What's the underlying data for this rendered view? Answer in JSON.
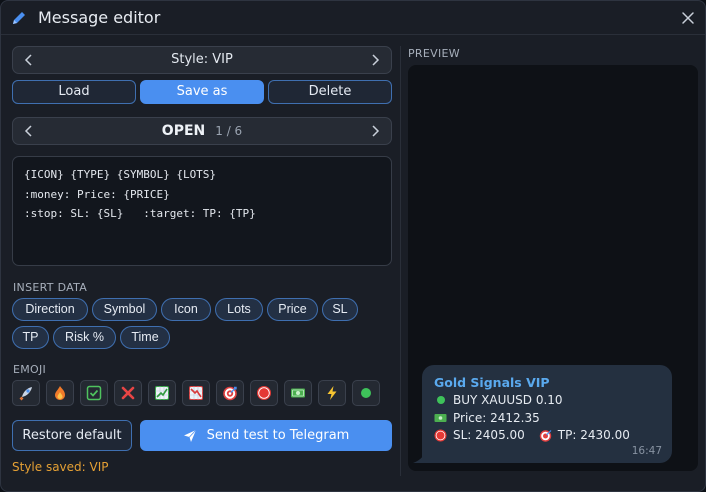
{
  "window": {
    "title": "Message editor"
  },
  "style_nav": {
    "label": "Style: VIP"
  },
  "actions": {
    "load": "Load",
    "save_as": "Save as",
    "delete": "Delete"
  },
  "template_nav": {
    "name": "OPEN",
    "count": "1 / 6"
  },
  "template_lines": [
    "{ICON} {TYPE} {SYMBOL} {LOTS}",
    ":money: Price: {PRICE}",
    ":stop: SL: {SL}   :target: TP: {TP}"
  ],
  "insert_data": {
    "label": "INSERT DATA",
    "chips": [
      "Direction",
      "Symbol",
      "Icon",
      "Lots",
      "Price",
      "SL",
      "TP",
      "Risk %",
      "Time"
    ]
  },
  "emoji": {
    "label": "EMOJI",
    "items": [
      "rocket-icon",
      "fire-icon",
      "check-icon",
      "cross-icon",
      "chart-up-icon",
      "chart-down-icon",
      "target-icon",
      "stop-icon",
      "money-icon",
      "lightning-icon",
      "green-dot-icon"
    ]
  },
  "footer": {
    "restore_label": "Restore default",
    "send_label": "Send test to Telegram",
    "status": "Style saved: VIP"
  },
  "preview": {
    "label": "PREVIEW",
    "message": {
      "title": "Gold Signals VIP",
      "line1": "BUY XAUUSD 0.10",
      "line2": "Price: 2412.35",
      "sl": "SL: 2405.00",
      "tp": "TP: 2430.00",
      "time": "16:47"
    }
  },
  "colors": {
    "accent": "#4a8ff0",
    "background": "#1a1e26",
    "status": "#e5a034",
    "preview_title": "#5aa9ee"
  }
}
